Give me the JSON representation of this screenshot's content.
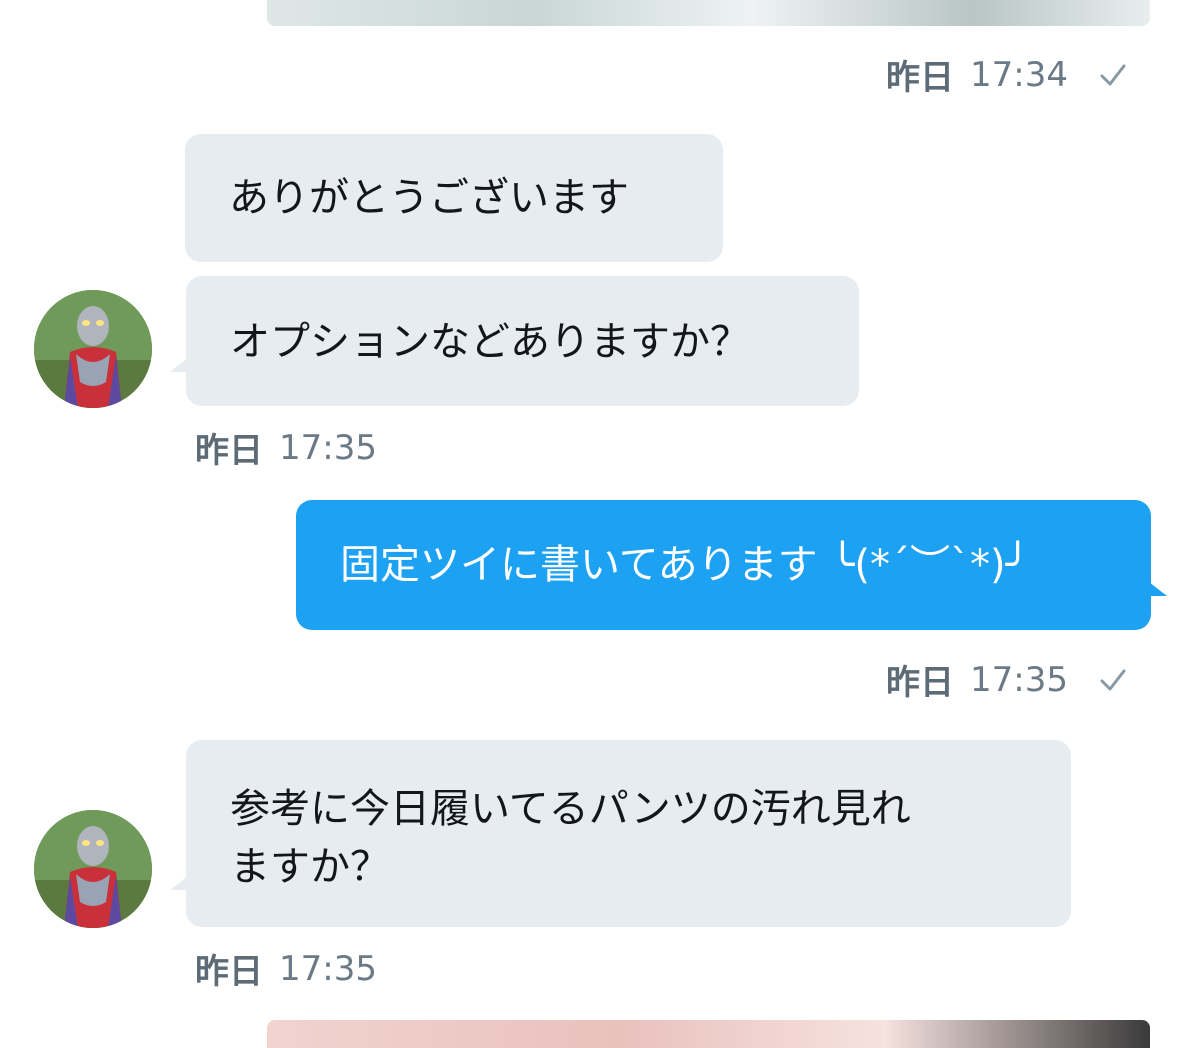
{
  "messages": [
    {
      "text": "ありがとうございます"
    },
    {
      "text": "オプションなどありますか？"
    },
    {
      "text": "固定ツイに書いてあります ╰(*´︶`*)╯"
    },
    {
      "lines": [
        "参考に今日履いてるパンツの汚れ見れ",
        "ますか？"
      ]
    }
  ],
  "meta": [
    {
      "day": "昨日",
      "time": "17:34"
    },
    {
      "day": "昨日",
      "time": "17:35"
    },
    {
      "day": "昨日",
      "time": "17:35"
    },
    {
      "day": "昨日",
      "time": "17:35"
    }
  ],
  "colors": {
    "incoming_bubble": "#e6ecf0",
    "outgoing_bubble": "#1da1f2",
    "meta_text": "#6b7a86"
  },
  "icons": {
    "read_receipt": "checkmark-icon",
    "avatar": "ultraman-avatar"
  }
}
